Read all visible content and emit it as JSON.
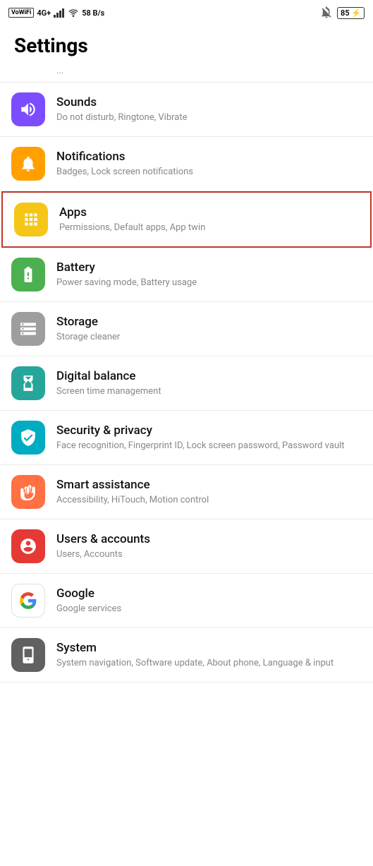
{
  "statusBar": {
    "left": {
      "wovifi": "VoWiFi",
      "signal": "4G+",
      "speed": "58\nB/s"
    },
    "right": {
      "battery": "85"
    }
  },
  "pageTitle": "Settings",
  "scrollHint": "...",
  "items": [
    {
      "id": "sounds",
      "iconColor": "icon-purple",
      "iconType": "volume",
      "title": "Sounds",
      "subtitle": "Do not disturb, Ringtone, Vibrate",
      "highlighted": false
    },
    {
      "id": "notifications",
      "iconColor": "icon-yellow",
      "iconType": "bell",
      "title": "Notifications",
      "subtitle": "Badges, Lock screen notifications",
      "highlighted": false
    },
    {
      "id": "apps",
      "iconColor": "icon-yellow-green",
      "iconType": "apps",
      "title": "Apps",
      "subtitle": "Permissions, Default apps, App twin",
      "highlighted": true
    },
    {
      "id": "battery",
      "iconColor": "icon-green",
      "iconType": "battery",
      "title": "Battery",
      "subtitle": "Power saving mode, Battery usage",
      "highlighted": false
    },
    {
      "id": "storage",
      "iconColor": "icon-gray",
      "iconType": "storage",
      "title": "Storage",
      "subtitle": "Storage cleaner",
      "highlighted": false
    },
    {
      "id": "digital-balance",
      "iconColor": "icon-teal",
      "iconType": "hourglass",
      "title": "Digital balance",
      "subtitle": "Screen time management",
      "highlighted": false
    },
    {
      "id": "security",
      "iconColor": "icon-cyan",
      "iconType": "shield",
      "title": "Security & privacy",
      "subtitle": "Face recognition, Fingerprint ID, Lock screen password, Password vault",
      "highlighted": false
    },
    {
      "id": "smart-assistance",
      "iconColor": "icon-orange",
      "iconType": "hand",
      "title": "Smart assistance",
      "subtitle": "Accessibility, HiTouch, Motion control",
      "highlighted": false
    },
    {
      "id": "users",
      "iconColor": "icon-red",
      "iconType": "user",
      "title": "Users & accounts",
      "subtitle": "Users, Accounts",
      "highlighted": false
    },
    {
      "id": "google",
      "iconColor": "icon-google",
      "iconType": "google",
      "title": "Google",
      "subtitle": "Google services",
      "highlighted": false
    },
    {
      "id": "system",
      "iconColor": "icon-dark-gray",
      "iconType": "info",
      "title": "System",
      "subtitle": "System navigation, Software update, About phone, Language & input",
      "highlighted": false
    }
  ]
}
